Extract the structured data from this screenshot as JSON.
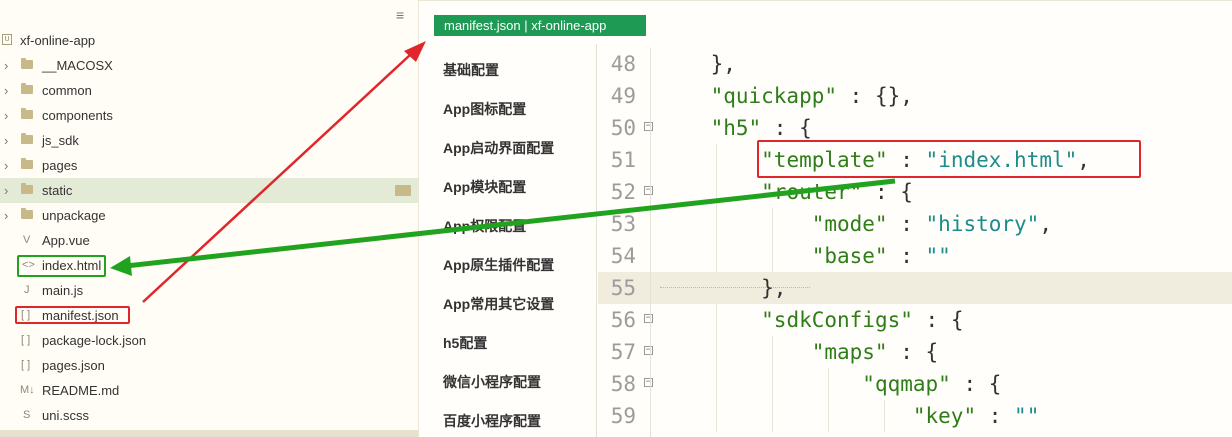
{
  "explorer": {
    "menu_icon": "≡",
    "root": "xf-online-app",
    "items": [
      {
        "label": "__MACOSX",
        "type": "folder"
      },
      {
        "label": "common",
        "type": "folder"
      },
      {
        "label": "components",
        "type": "folder"
      },
      {
        "label": "js_sdk",
        "type": "folder"
      },
      {
        "label": "pages",
        "type": "folder"
      },
      {
        "label": "static",
        "type": "folder"
      },
      {
        "label": "unpackage",
        "type": "folder"
      },
      {
        "label": "App.vue",
        "type": "file",
        "icon": "V"
      },
      {
        "label": "index.html",
        "type": "file",
        "icon": "<>"
      },
      {
        "label": "main.js",
        "type": "file",
        "icon": "J"
      },
      {
        "label": "manifest.json",
        "type": "file",
        "icon": "[ ]"
      },
      {
        "label": "package-lock.json",
        "type": "file",
        "icon": "[ ]"
      },
      {
        "label": "pages.json",
        "type": "file",
        "icon": "[ ]"
      },
      {
        "label": "README.md",
        "type": "file",
        "icon": "M↓"
      },
      {
        "label": "uni.scss",
        "type": "file",
        "icon": "S"
      }
    ]
  },
  "editor": {
    "tab_label": "manifest.json | xf-online-app"
  },
  "categories": [
    "基础配置",
    "App图标配置",
    "App启动界面配置",
    "App模块配置",
    "App权限配置",
    "App原生插件配置",
    "App常用其它设置",
    "h5配置",
    "微信小程序配置",
    "百度小程序配置"
  ],
  "code": {
    "lines": [
      {
        "num": "48",
        "text": "    },"
      },
      {
        "num": "49",
        "text": "    \"quickapp\" : {},"
      },
      {
        "num": "50",
        "text": "    \"h5\" : {"
      },
      {
        "num": "51",
        "text": "        \"template\" : \"index.html\","
      },
      {
        "num": "52",
        "text": "        \"router\" : {"
      },
      {
        "num": "53",
        "text": "            \"mode\" : \"history\","
      },
      {
        "num": "54",
        "text": "            \"base\" : \"\""
      },
      {
        "num": "55",
        "text": "        },"
      },
      {
        "num": "56",
        "text": "        \"sdkConfigs\" : {"
      },
      {
        "num": "57",
        "text": "            \"maps\" : {"
      },
      {
        "num": "58",
        "text": "                \"qqmap\" : {"
      },
      {
        "num": "59",
        "text": "                    \"key\" : \"\""
      }
    ]
  },
  "colors": {
    "tab_bg": "#1f9a55",
    "annotation_red": "#e0262b",
    "annotation_green": "#22a31f",
    "json_key": "#2f7d18",
    "json_string": "#1d8c8c"
  }
}
